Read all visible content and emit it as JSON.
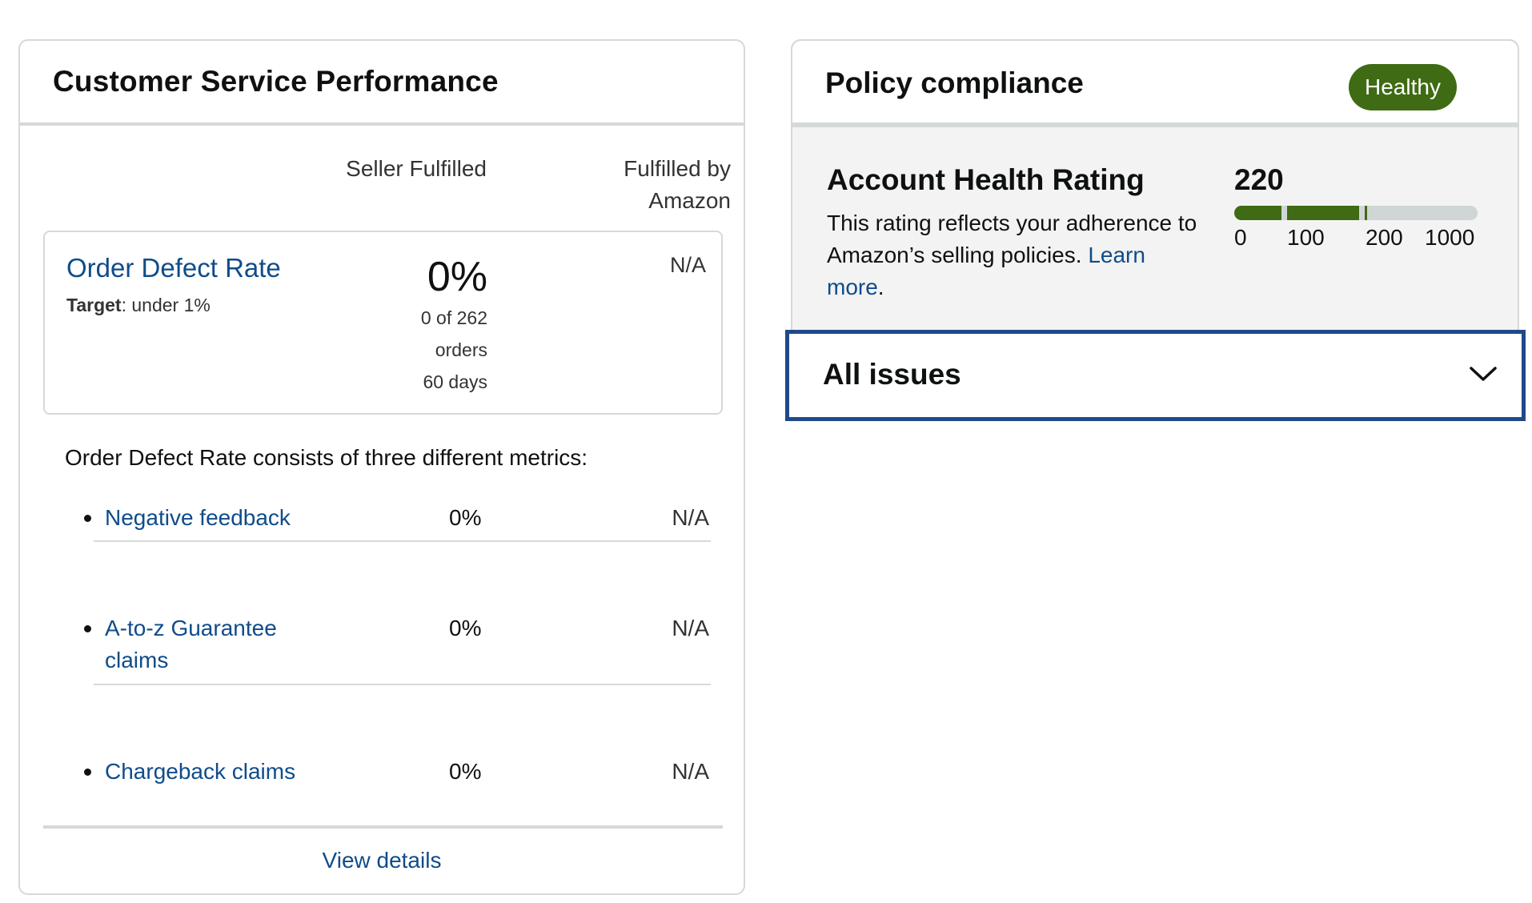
{
  "customer_service": {
    "title": "Customer Service Performance",
    "col_seller": "Seller Fulfilled",
    "col_fba_line1": "Fulfilled by",
    "col_fba_line2": "Amazon",
    "odr": {
      "label": "Order Defect Rate",
      "target_prefix": "Target",
      "target_value": ": under 1%",
      "seller_value": "0%",
      "seller_sub1": "0 of 262",
      "seller_sub2": "orders",
      "seller_sub3": "60 days",
      "fba_value": "N/A"
    },
    "metrics_intro": "Order Defect Rate consists of three different metrics:",
    "metrics": [
      {
        "label": "Negative feedback",
        "seller": "0%",
        "fba": "N/A"
      },
      {
        "label": "A-to-z Guarantee claims",
        "seller": "0%",
        "fba": "N/A"
      },
      {
        "label": "Chargeback claims",
        "seller": "0%",
        "fba": "N/A"
      }
    ],
    "view_details": "View details"
  },
  "policy": {
    "title": "Policy compliance",
    "status_badge": "Healthy",
    "status_color": "#3e6b13",
    "ahr_title": "Account Health Rating",
    "ahr_desc": "This rating reflects your adherence to Amazon’s selling policies.",
    "learn_more": "Learn more",
    "learn_more_suffix": ".",
    "score": "220",
    "scale_ticks": [
      "0",
      "100",
      "200",
      "1000"
    ],
    "all_issues": "All issues"
  }
}
